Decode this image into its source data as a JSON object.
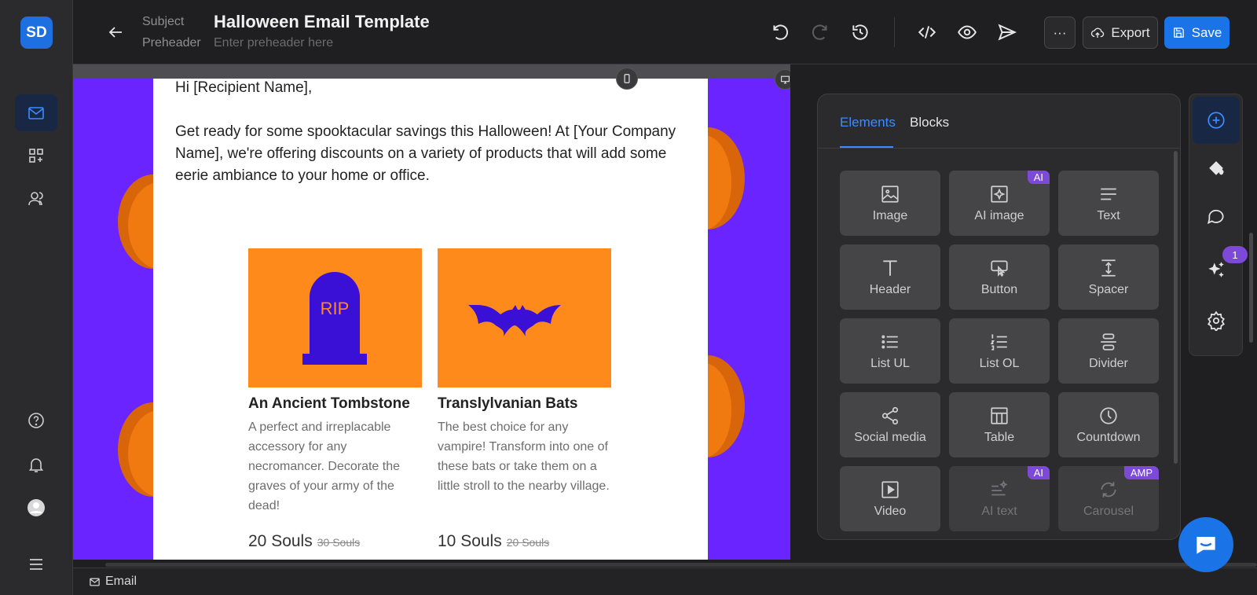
{
  "app": {
    "logo": "SD"
  },
  "header": {
    "subject_label": "Subject",
    "preheader_label": "Preheader",
    "title": "Halloween Email Template",
    "preheader_placeholder": "Enter preheader here",
    "more_label": "···",
    "export_label": "Export",
    "save_label": "Save"
  },
  "email": {
    "greeting": "Hi [Recipient Name],",
    "intro": "Get ready for some spooktacular savings this Halloween! At [Your Company Name], we're offering discounts on a variety of products that will add some eerie ambiance to your home or office.",
    "products": [
      {
        "image_text": "RIP",
        "name": "An Ancient Tombstone",
        "description": "A perfect and irreplacable accessory for any necromancer. Decorate the graves of your army of the dead!",
        "price": "20 Souls",
        "old_price": "30 Souls"
      },
      {
        "name": "Translylvanian Bats",
        "description": "The best choice for any vampire! Transform into one of these bats or take them on a little stroll to the nearby village.",
        "price": "10 Souls",
        "old_price": "20 Souls"
      }
    ]
  },
  "panel": {
    "tabs": [
      "Elements",
      "Blocks"
    ],
    "tiles": [
      {
        "label": "Image",
        "icon": "image-icon"
      },
      {
        "label": "AI image",
        "icon": "ai-image-icon",
        "badge": "AI"
      },
      {
        "label": "Text",
        "icon": "text-icon"
      },
      {
        "label": "Header",
        "icon": "header-icon"
      },
      {
        "label": "Button",
        "icon": "button-icon"
      },
      {
        "label": "Spacer",
        "icon": "spacer-icon"
      },
      {
        "label": "List UL",
        "icon": "list-ul-icon"
      },
      {
        "label": "List OL",
        "icon": "list-ol-icon"
      },
      {
        "label": "Divider",
        "icon": "divider-icon"
      },
      {
        "label": "Social media",
        "icon": "share-icon"
      },
      {
        "label": "Table",
        "icon": "table-icon"
      },
      {
        "label": "Countdown",
        "icon": "clock-icon"
      },
      {
        "label": "Video",
        "icon": "video-icon"
      },
      {
        "label": "AI text",
        "icon": "ai-text-icon",
        "badge": "AI"
      },
      {
        "label": "Carousel",
        "icon": "carousel-icon",
        "badge": "AMP"
      }
    ]
  },
  "right_rail": {
    "notification_count": "1"
  },
  "footer": {
    "crumb": "Email"
  },
  "colors": {
    "accent": "#1b73e8",
    "canvas_bg": "#6a24ff",
    "product_bg": "#ff8a1c",
    "product_fg": "#3a0fd6",
    "ai_badge": "#7d4ad8"
  }
}
